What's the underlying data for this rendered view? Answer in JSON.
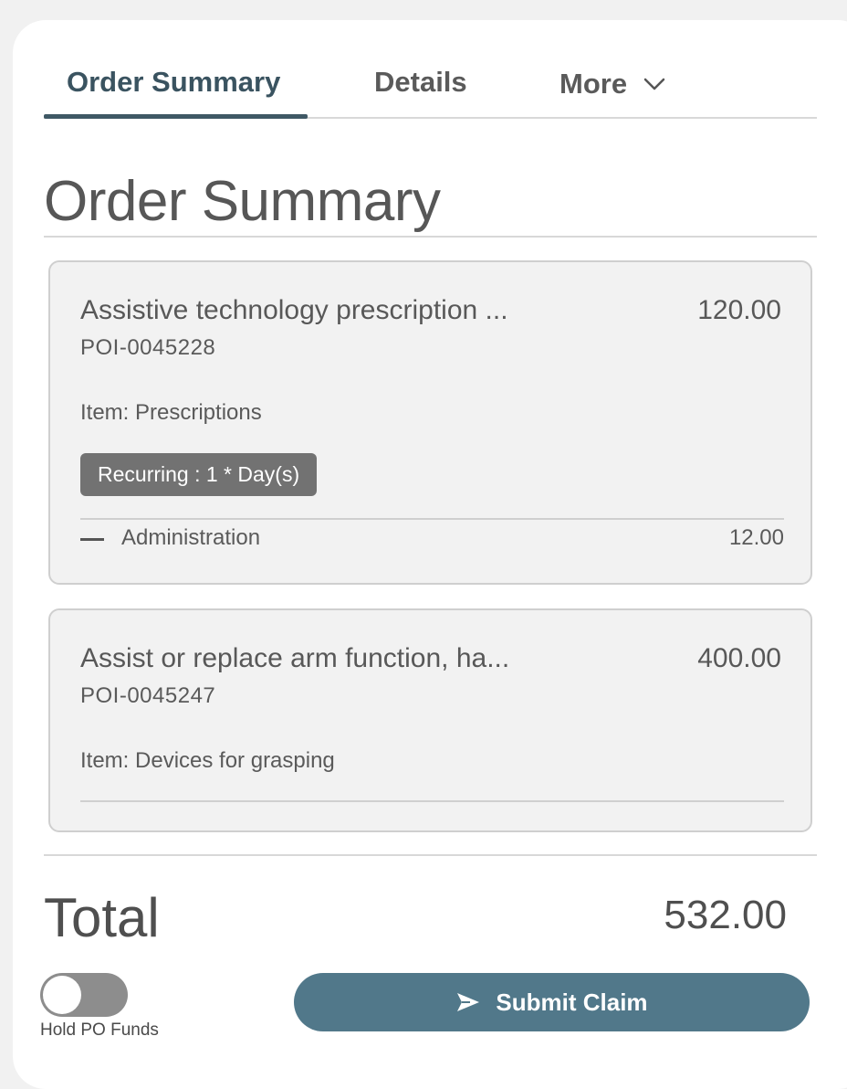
{
  "tabs": [
    {
      "label": "Order Summary",
      "active": true
    },
    {
      "label": "Details",
      "active": false
    },
    {
      "label": "More",
      "active": false
    }
  ],
  "section_title": "Order Summary",
  "items": [
    {
      "name": "Assistive technology prescription ...",
      "price": "120.00",
      "poi": "POI-0045228",
      "category": "Item: Prescriptions",
      "badge": "Recurring : 1 * Day(s)",
      "sub_item": {
        "label": "Administration",
        "value": "12.00"
      }
    },
    {
      "name": "Assist or replace arm function, ha...",
      "price": "400.00",
      "poi": "POI-0045247",
      "category": "Item: Devices for grasping"
    }
  ],
  "total": {
    "label": "Total",
    "value": "532.00"
  },
  "hold_funds": {
    "label": "Hold PO Funds",
    "enabled": false
  },
  "submit": {
    "label": "Submit Claim",
    "icon": "send-icon"
  },
  "colors": {
    "accent": "#51788a",
    "tab_active": "#3f5865",
    "badge": "#727272"
  }
}
